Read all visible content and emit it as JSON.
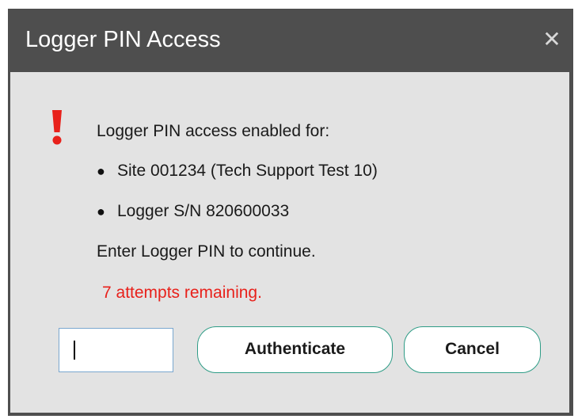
{
  "window": {
    "title": "Logger PIN Access",
    "close_glyph": "✕",
    "close_icon": "close-icon"
  },
  "alert": {
    "icon": "exclamation-icon",
    "color": "#e8211b"
  },
  "message": {
    "intro": "Logger PIN access enabled for:",
    "items": [
      "Site 001234 (Tech Support Test 10)",
      "Logger S/N 820600033"
    ],
    "instruction": "Enter Logger PIN to continue.",
    "attempts": "7 attempts remaining."
  },
  "pin_input": {
    "value": "",
    "placeholder": ""
  },
  "buttons": {
    "authenticate": "Authenticate",
    "cancel": "Cancel"
  },
  "colors": {
    "titlebar": "#4e4e4e",
    "body": "#e3e3e3",
    "warning_text": "#e8211b",
    "button_border": "#2e9c86",
    "input_border": "#7aa7cf"
  }
}
